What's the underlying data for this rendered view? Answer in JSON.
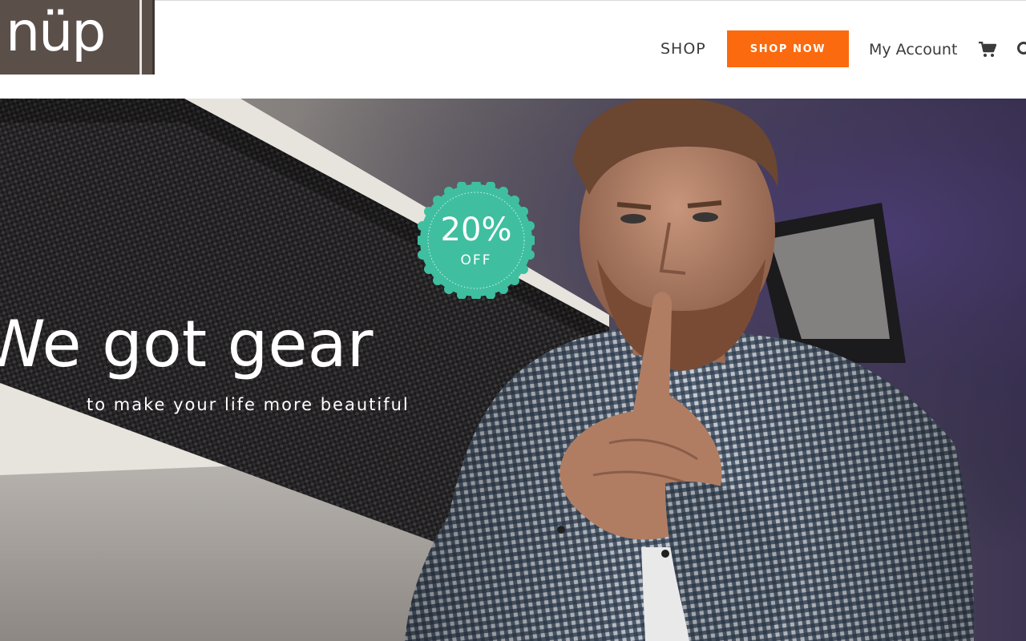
{
  "header": {
    "logo_text": "nüp",
    "nav": {
      "shop_label": "SHOP",
      "shop_now_label": "SHOP NOW",
      "account_label": "My Account"
    },
    "icons": {
      "cart": "shopping-cart-icon",
      "search": "search-icon"
    }
  },
  "hero": {
    "headline": "We got gear",
    "subheadline": "to make your life more beautiful",
    "badge": {
      "percent": "20%",
      "off": "OFF"
    }
  },
  "colors": {
    "brand": "#5b4f49",
    "accent": "#fb6a0f",
    "badge": "#3fbfa0",
    "nav_text": "#3b3b3b"
  }
}
